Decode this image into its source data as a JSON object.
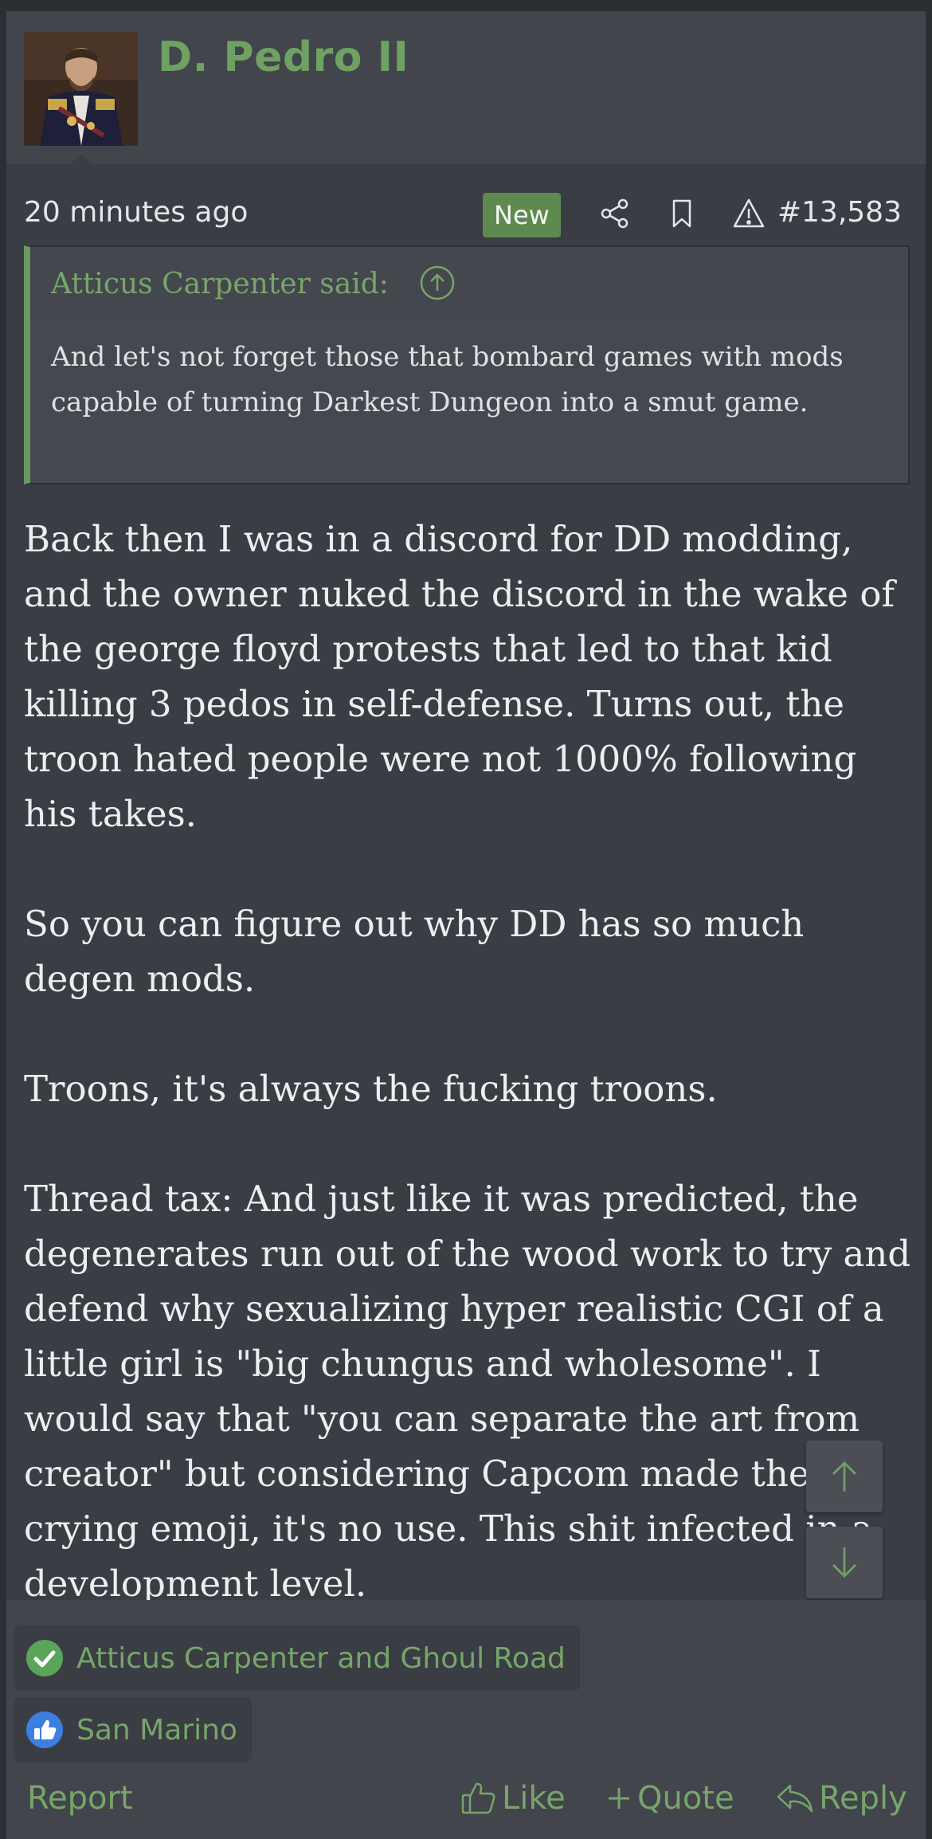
{
  "post": {
    "author": "D. Pedro II",
    "time": "20 minutes ago",
    "badge_new": "New",
    "post_number": "#13,583"
  },
  "quote": {
    "author_said": "Atticus Carpenter said:",
    "text": "And let's not forget those that bombard games with mods capable of turning Darkest Dungeon into a smut game."
  },
  "message": {
    "paragraphs": [
      "Back then I was in a discord for DD modding, and the owner nuked the discord in the wake of the george floyd protests that led to that kid killing 3 pedos in self-defense. Turns out, the troon hated people were not 1000% following his takes.",
      "So you can figure out why DD has so much degen mods.",
      "Troons, it's always the fucking troons.",
      "Thread tax: And just like it was predicted, the degenerates run out of the wood work to try and defend why sexualizing hyper realistic CGI of a little girl is \"big chungus and wholesome\". I would say that \"you can separate the art from creator\" but considering Capcom made the crying emoji, it's no use. This shit infected in a development level."
    ]
  },
  "reactions": [
    {
      "icon": "checkmark-icon",
      "text": "Atticus Carpenter and Ghoul Road",
      "color": "#5aa55a"
    },
    {
      "icon": "thumbs-up-icon",
      "text": "San Marino",
      "color": "#3d7fe0"
    }
  ],
  "actions": {
    "report": "Report",
    "like": "Like",
    "quote": "Quote",
    "reply": "Reply"
  },
  "colors": {
    "accent_green": "#77a56a",
    "badge_green": "#5e8a4f",
    "background": "#3a3d43"
  }
}
